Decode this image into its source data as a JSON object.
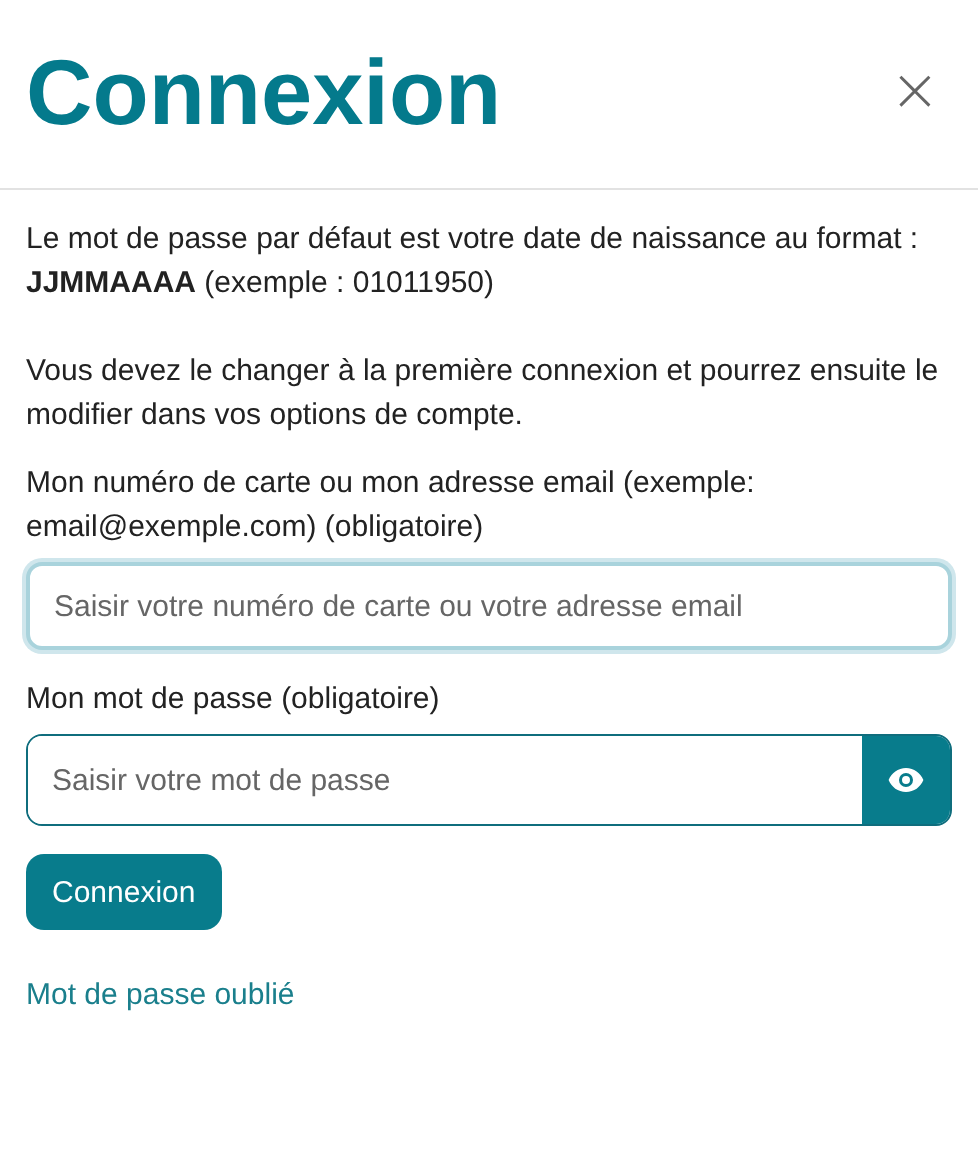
{
  "dialog": {
    "title": "Connexion",
    "close": "×"
  },
  "intro": [
    "Le mot de passe par défaut est votre date de naissance au format :",
    "**JJMMAAAA** (exemple : 01011950)"
  ],
  "notice": "Vous devez le changer à la première connexion et pourrez ensuite le modifier dans vos options de compte.",
  "fields": [
    {
      "kind": "text",
      "label": "Mon numéro de carte ou mon adresse email (exemple: email@exemple.com) (obligatoire)",
      "placeholder": "Saisir votre numéro de carte ou votre adresse email",
      "focused": true
    },
    {
      "kind": "password",
      "label": "Mon mot de passe (obligatoire)",
      "placeholder": "Saisir votre mot de passe",
      "focused": false
    }
  ],
  "submit": "Connexion",
  "forgot_link": "Mot de passe oublié"
}
